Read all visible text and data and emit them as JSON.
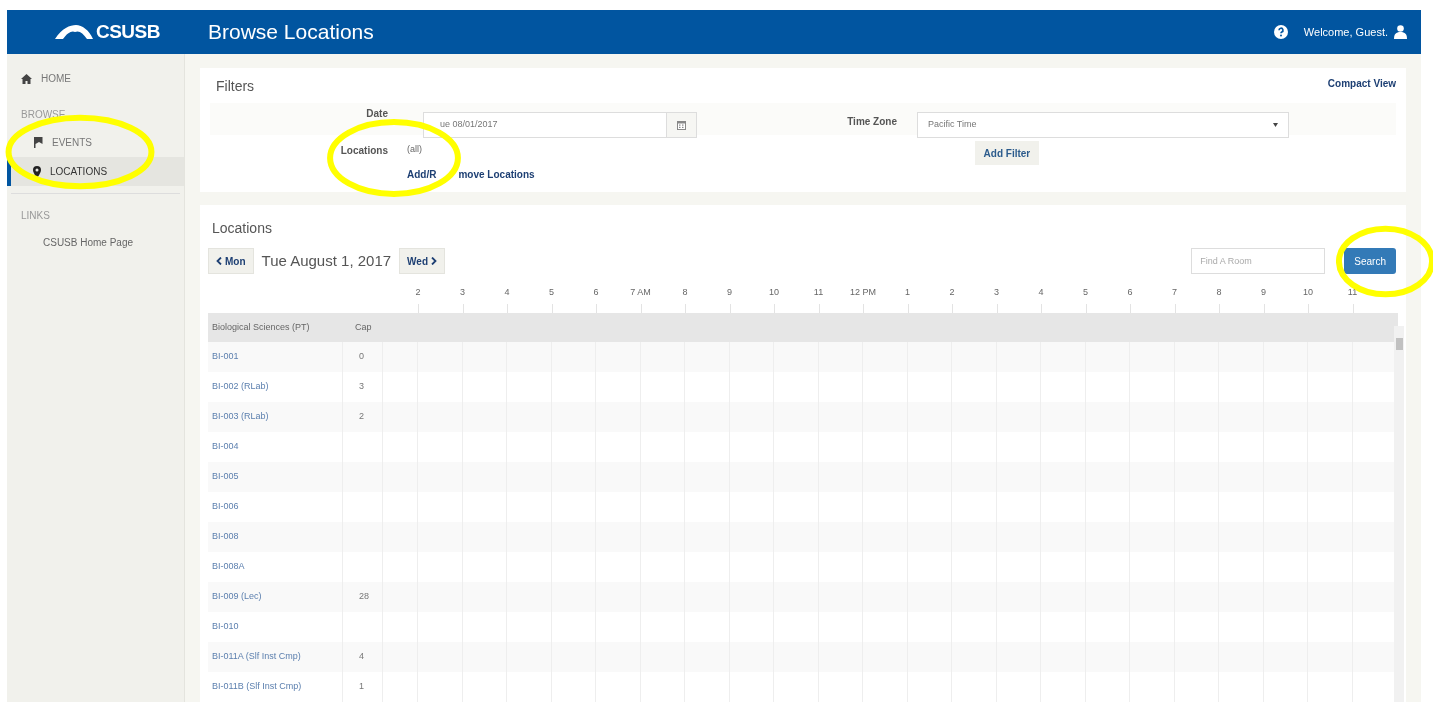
{
  "header": {
    "logo": "CSUSB",
    "title": "Browse Locations",
    "welcome": "Welcome, Guest."
  },
  "sidebar": {
    "items": [
      {
        "kind": "link",
        "label": "HOME",
        "selected": false
      },
      {
        "kind": "heading",
        "label": "BROWSE"
      },
      {
        "kind": "link",
        "label": "EVENTS",
        "selected": false
      },
      {
        "kind": "link",
        "label": "LOCATIONS",
        "selected": true
      },
      {
        "kind": "heading",
        "label": "LINKS"
      },
      {
        "kind": "sublink",
        "label": "CSUSB Home Page"
      }
    ]
  },
  "filters": {
    "title": "Filters",
    "compact_view": "Compact View",
    "date_label": "Date",
    "date_value": "ue 08/01/2017",
    "time_zone_label": "Time Zone",
    "time_zone_value": "Pacific Time",
    "locations_label": "Locations",
    "locations_value": "(all)",
    "add_remove_visible_parts": [
      "Add/R",
      "move Locations"
    ],
    "add_filter": "Add Filter"
  },
  "locations": {
    "title": "Locations",
    "prev_button": "Mon",
    "date": "Tue August 1, 2017",
    "next_button": "Wed",
    "search_placeholder": "Find A Room",
    "search_button": "Search",
    "hours": [
      "2",
      "3",
      "4",
      "5",
      "6",
      "7 AM",
      "8",
      "9",
      "10",
      "11",
      "12 PM",
      "1",
      "2",
      "3",
      "4",
      "5",
      "6",
      "7",
      "8",
      "9",
      "10",
      "11"
    ],
    "table": {
      "columns": [
        "Biological Sciences (PT)",
        "Cap"
      ],
      "rows": [
        {
          "name": "BI-001",
          "cap": "0"
        },
        {
          "name": "BI-002 (RLab)",
          "cap": "3"
        },
        {
          "name": "BI-003 (RLab)",
          "cap": "2"
        },
        {
          "name": "BI-004"
        },
        {
          "name": "BI-005"
        },
        {
          "name": "BI-006"
        },
        {
          "name": "BI-008"
        },
        {
          "name": "BI-008A"
        },
        {
          "name": "BI-009 (Lec)",
          "cap": "28"
        },
        {
          "name": "BI-010"
        },
        {
          "name": "BI-011A (Slf Inst Cmp)",
          "cap": "4"
        },
        {
          "name": "BI-011B (Slf Inst Cmp)",
          "cap": "1"
        }
      ]
    }
  },
  "annotations": [
    {
      "kind": "ellipse"
    },
    {
      "kind": "ellipse"
    },
    {
      "kind": "ellipse"
    }
  ]
}
